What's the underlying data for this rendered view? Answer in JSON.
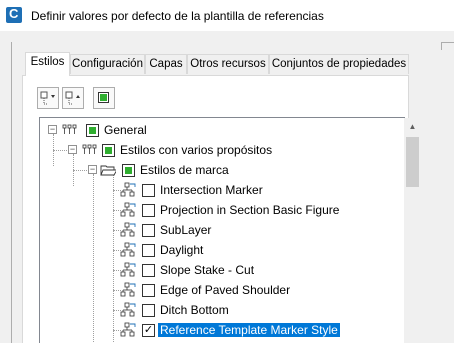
{
  "window": {
    "title": "Definir valores por defecto de la plantilla de referencias",
    "app_icon": "civil3d-logo"
  },
  "tabs": [
    {
      "label": "Estilos",
      "active": true
    },
    {
      "label": "Configuración",
      "active": false
    },
    {
      "label": "Capas",
      "active": false
    },
    {
      "label": "Otros recursos",
      "active": false
    },
    {
      "label": "Conjuntos de propiedades",
      "active": false
    }
  ],
  "toolbar": {
    "expand_all_icon": "expand-all-icon",
    "collapse_all_icon": "collapse-all-icon",
    "toggle_all_icon": "toggle-all-icon"
  },
  "tree": {
    "root": {
      "label": "General",
      "expanded": true,
      "state": "partial"
    },
    "level1": {
      "label": "Estilos con varios propósitos",
      "expanded": true,
      "state": "partial"
    },
    "level2": {
      "label": "Estilos de marca",
      "expanded": true,
      "state": "partial"
    },
    "items": [
      {
        "label": "Intersection Marker",
        "checked": false,
        "selected": false
      },
      {
        "label": "Projection in Section Basic Figure",
        "checked": false,
        "selected": false
      },
      {
        "label": "SubLayer",
        "checked": false,
        "selected": false
      },
      {
        "label": "Daylight",
        "checked": false,
        "selected": false
      },
      {
        "label": "Slope Stake - Cut",
        "checked": false,
        "selected": false
      },
      {
        "label": "Edge of Paved Shoulder",
        "checked": false,
        "selected": false
      },
      {
        "label": "Ditch Bottom",
        "checked": false,
        "selected": false
      },
      {
        "label": "Reference Template Marker Style",
        "checked": true,
        "selected": true
      }
    ]
  },
  "colors": {
    "selection": "#0078d7",
    "partial_check": "#2fae2f"
  }
}
